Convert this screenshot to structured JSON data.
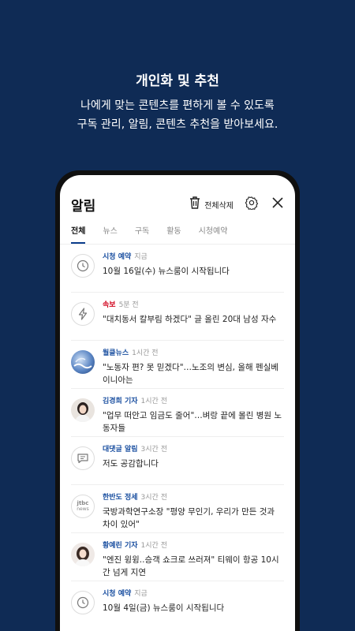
{
  "promo": {
    "title": "개인화 및 추천",
    "subtitle_line1": "나에게 맞는 콘텐츠를 편하게 볼 수 있도록",
    "subtitle_line2": "구독 관리, 알림, 콘텐츠 추천을 받아보세요."
  },
  "header": {
    "title": "알림",
    "delete_all_label": "전체삭제"
  },
  "tabs": [
    {
      "label": "전체",
      "active": true
    },
    {
      "label": "뉴스",
      "active": false
    },
    {
      "label": "구독",
      "active": false
    },
    {
      "label": "활동",
      "active": false
    },
    {
      "label": "시청예약",
      "active": false
    }
  ],
  "notifications": [
    {
      "source": "시청 예약",
      "time": "지금",
      "text": "10월 16일(수) 뉴스룸이 시작됩니다",
      "icon": "clock-icon"
    },
    {
      "source": "속보",
      "time": "5분 전",
      "text": "\"대치동서 칼부림 하겠다\" 글 올린 20대 남성 자수",
      "icon": "lightning-icon"
    },
    {
      "source": "월클뉴스",
      "time": "1시간 전",
      "text": "\"노동자 편? 못 믿겠다\"…노조의 변심, 올해 펜실베이니아는",
      "icon": "news-thumbnail"
    },
    {
      "source": "김경희 기자",
      "time": "1시간 전",
      "text": "\"업무 떠안고 임금도 줄어\"…벼랑 끝에 몰린 병원 노동자들",
      "icon": "reporter-avatar"
    },
    {
      "source": "대댓글 알림",
      "time": "3시간 전",
      "text": "저도 공감합니다",
      "icon": "comment-icon"
    },
    {
      "source": "한반도 정세",
      "time": "3시간 전",
      "text": "국방과학연구소장 \"평양 무인기, 우리가 만든 것과 차이 있어\"",
      "icon": "jtbc-news-logo",
      "logo_text_1": "jtbc",
      "logo_text_2": "news"
    },
    {
      "source": "황예린 기자",
      "time": "1시간 전",
      "text": "\"엔진 윙윙..승객 쇼크로 쓰러져\" 티웨이 항공 10시간 넘게 지연",
      "icon": "reporter-avatar"
    },
    {
      "source": "시청 예약",
      "time": "지금",
      "text": "10월 4일(금) 뉴스룸이 시작됩니다",
      "icon": "clock-icon"
    }
  ],
  "colors": {
    "background": "#0f2b55",
    "accent": "#1a4fa0",
    "breaking": "#d0021b"
  }
}
